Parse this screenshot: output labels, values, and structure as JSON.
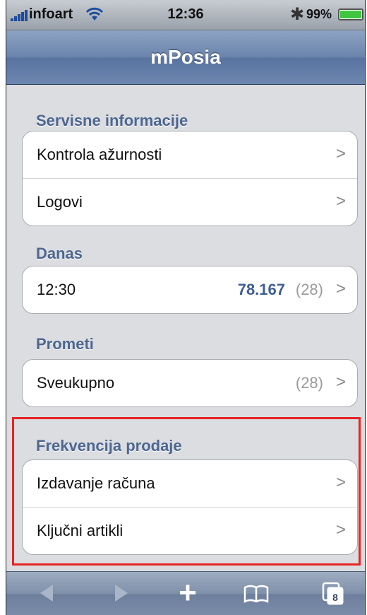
{
  "status_bar": {
    "carrier": "infoart",
    "time": "12:36",
    "battery_percent": "99%",
    "bluetooth_glyph": "✱"
  },
  "nav": {
    "title": "mPosia"
  },
  "sections": [
    {
      "title": "Servisne informacije",
      "rows": [
        {
          "label": "Kontrola ažurnosti"
        },
        {
          "label": "Logovi"
        }
      ]
    },
    {
      "title": "Danas",
      "rows": [
        {
          "label": "12:30",
          "value": "78.167",
          "count": "(28)"
        }
      ]
    },
    {
      "title": "Prometi",
      "rows": [
        {
          "label": "Sveukupno",
          "count": "(28)"
        }
      ]
    },
    {
      "title": "Frekvencija prodaje",
      "rows": [
        {
          "label": "Izdavanje računa"
        },
        {
          "label": "Ključni artikli"
        }
      ]
    }
  ],
  "toolbar": {
    "plus_glyph": "+",
    "pages_count": "8"
  },
  "chevron": ">",
  "colors": {
    "accent": "#4c6690",
    "value": "#3e5e95",
    "highlight": "#e62424",
    "battery": "#3fc540"
  }
}
